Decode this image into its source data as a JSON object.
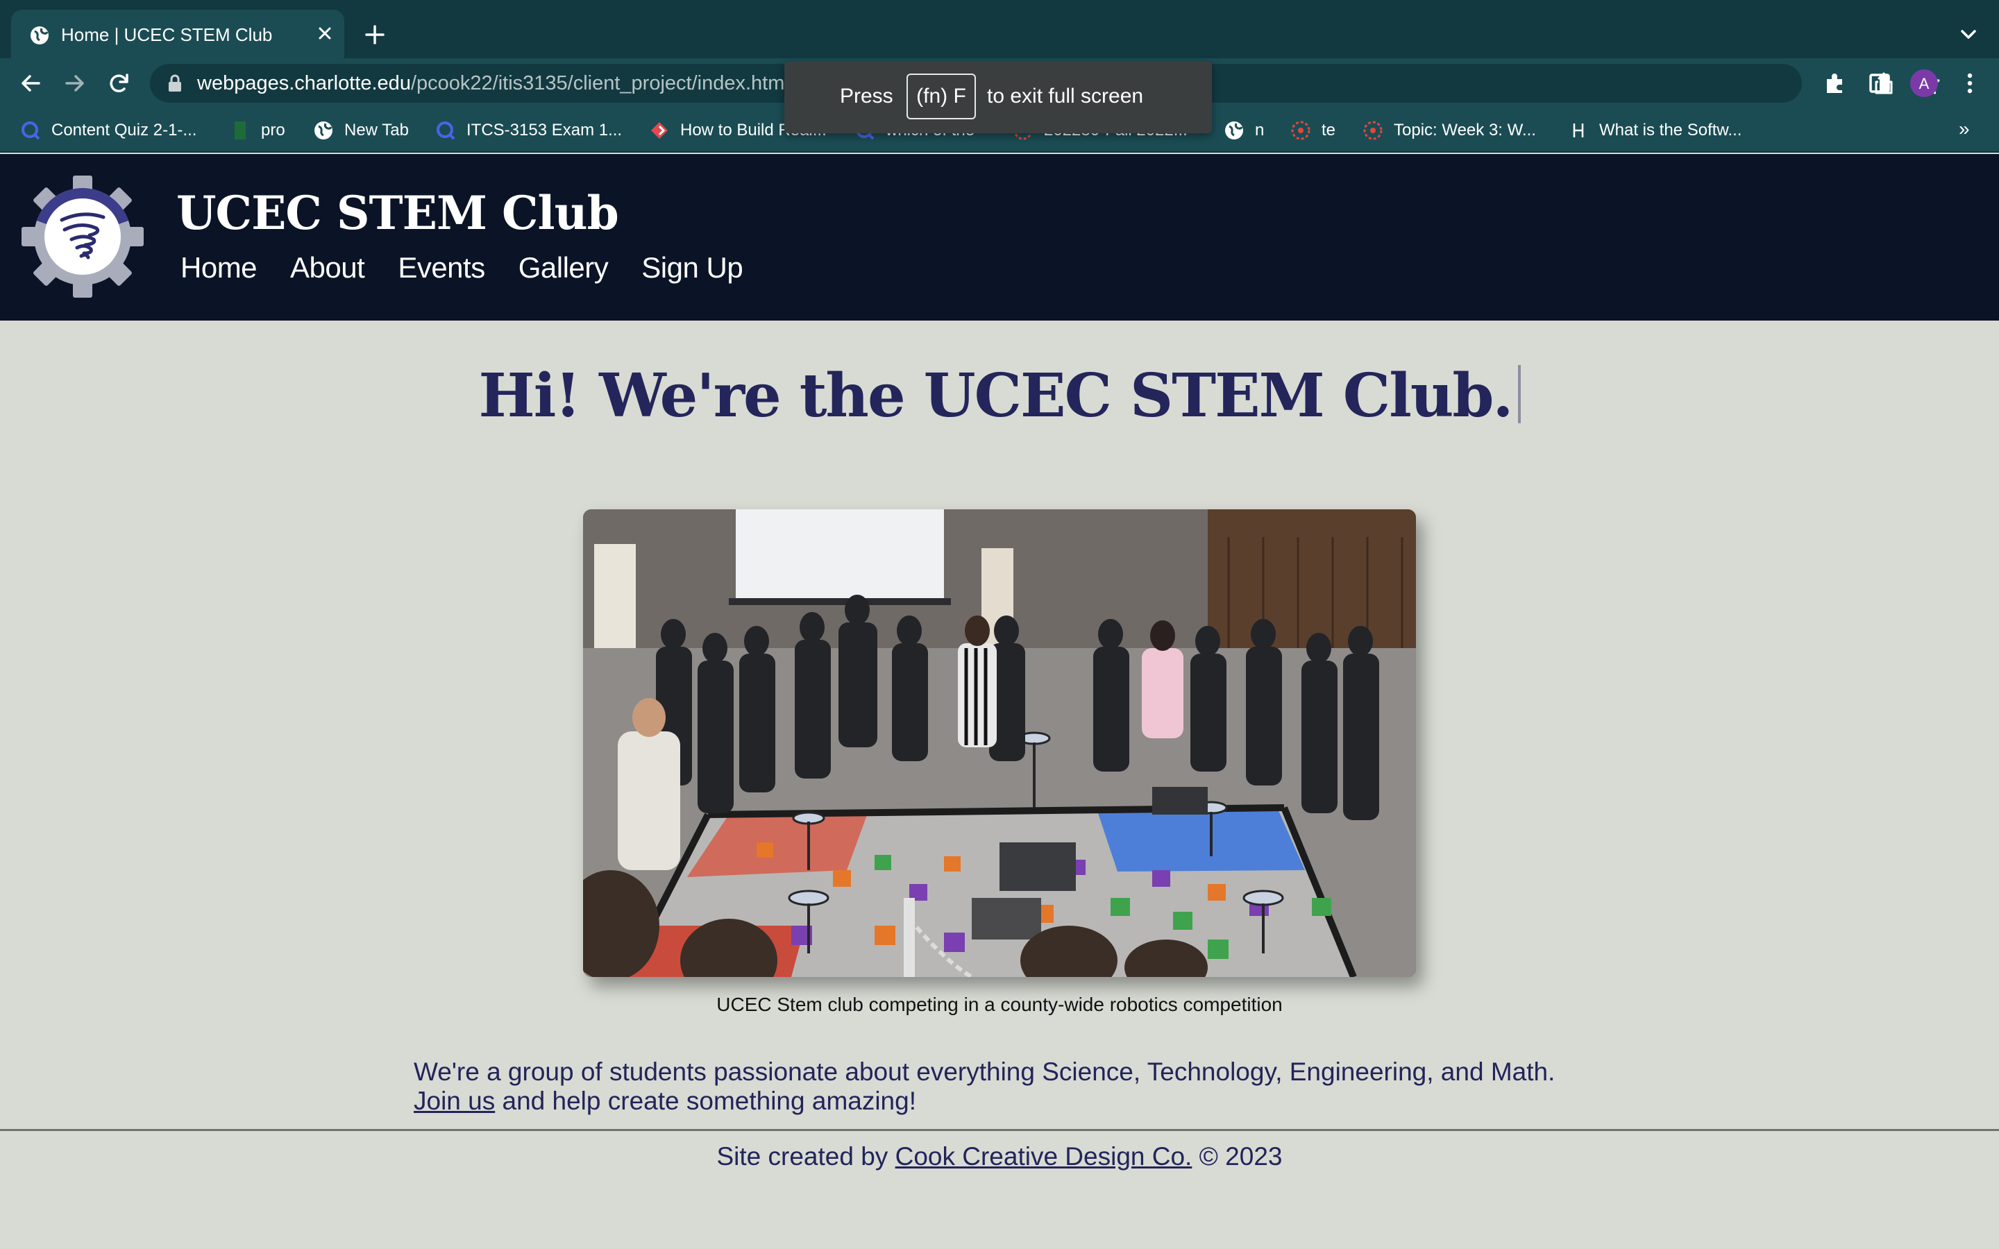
{
  "browser": {
    "tab": {
      "title": "Home | UCEC STEM Club"
    },
    "url": {
      "domain": "webpages.charlotte.edu",
      "path": "/pcook22/itis3135/client_project/index.html"
    },
    "profile_initial": "A",
    "bookmarks": [
      {
        "label": "Content Quiz 2-1-...",
        "icon": "quiz-q-icon"
      },
      {
        "label": "pro",
        "icon": "sheet-icon"
      },
      {
        "label": "New Tab",
        "icon": "globe-icon"
      },
      {
        "label": "ITCS-3153 Exam 1...",
        "icon": "quiz-q-icon"
      },
      {
        "label": "How to Build Real...",
        "icon": "diamond-icon"
      },
      {
        "label": "which of the",
        "icon": "quiz-q-icon"
      },
      {
        "label": "202280-Fall 2022...",
        "icon": "canvas-icon"
      },
      {
        "label": "n",
        "icon": "globe-icon"
      },
      {
        "label": "te",
        "icon": "canvas-icon"
      },
      {
        "label": "Topic: Week 3: W...",
        "icon": "canvas-icon"
      },
      {
        "label": "What is the Softw...",
        "icon": "h-letter-icon"
      }
    ],
    "more_bookmarks": "»",
    "fullscreen_toast": {
      "press": "Press",
      "key": "(fn) F",
      "rest": "to exit full screen"
    }
  },
  "site": {
    "title": "UCEC STEM Club",
    "nav": [
      "Home",
      "About",
      "Events",
      "Gallery",
      "Sign Up"
    ],
    "headline": "Hi! We're the UCEC STEM Club.",
    "hero_caption": "UCEC Stem club competing in a county-wide robotics competition",
    "intro": {
      "text_before": "We're a group of students passionate about everything Science, Technology, Engineering, and Math. ",
      "link": "Join us",
      "text_after": " and help create something amazing!"
    },
    "footer": {
      "prefix": "Site created by ",
      "link": "Cook Creative Design Co.",
      "suffix": " © 2023"
    }
  },
  "colors": {
    "page_bg": "#d8dbd3",
    "header_bg": "#0b1326",
    "heading_text": "#24255a",
    "browser_frame": "#123940",
    "browser_toolbar": "#1b4c54"
  }
}
